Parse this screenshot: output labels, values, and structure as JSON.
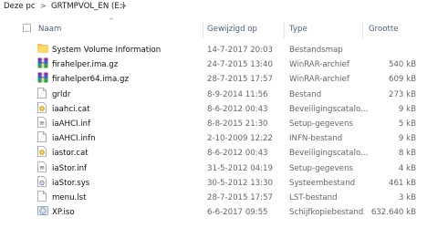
{
  "breadcrumb": {
    "items": [
      "Deze pc",
      "GRTMPVOL_EN (E:)"
    ],
    "separator": ">"
  },
  "columns": {
    "name": "Naam",
    "date": "Gewijzigd op",
    "type": "Type",
    "size": "Grootte"
  },
  "sort_indicator": "^",
  "files": [
    {
      "name": "System Volume Information",
      "date": "14-7-2017 20:03",
      "type": "Bestandsmap",
      "size": "",
      "icon": "folder-icon"
    },
    {
      "name": "firahelper.ima.gz",
      "date": "24-7-2015 13:40",
      "type": "WinRAR-archief",
      "size": "540 kB",
      "icon": "winrar-archive-icon"
    },
    {
      "name": "firahelper64.ima.gz",
      "date": "28-7-2015 17:57",
      "type": "WinRAR-archief",
      "size": "609 kB",
      "icon": "winrar-archive-icon"
    },
    {
      "name": "grldr",
      "date": "8-9-2014 11:56",
      "type": "Bestand",
      "size": "273 kB",
      "icon": "generic-file-icon"
    },
    {
      "name": "iaahci.cat",
      "date": "8-6-2012 00:43",
      "type": "Beveiligingscatalo...",
      "size": "9 kB",
      "icon": "security-catalog-icon"
    },
    {
      "name": "iaAHCI.inf",
      "date": "8-8-2015 21:30",
      "type": "Setup-gegevens",
      "size": "5 kB",
      "icon": "setup-info-icon"
    },
    {
      "name": "iaAHCI.infn",
      "date": "2-10-2009 12:22",
      "type": "INFN-bestand",
      "size": "9 kB",
      "icon": "generic-file-icon"
    },
    {
      "name": "iastor.cat",
      "date": "8-6-2012 00:43",
      "type": "Beveiligingscatalo...",
      "size": "8 kB",
      "icon": "security-catalog-icon"
    },
    {
      "name": "iaStor.inf",
      "date": "31-5-2012 04:19",
      "type": "Setup-gegevens",
      "size": "4 kB",
      "icon": "setup-info-icon"
    },
    {
      "name": "iaStor.sys",
      "date": "30-5-2012 13:30",
      "type": "Systeembestand",
      "size": "461 kB",
      "icon": "system-file-icon"
    },
    {
      "name": "menu.lst",
      "date": "28-7-2015 17:57",
      "type": "LST-bestand",
      "size": "3 kB",
      "icon": "generic-file-icon"
    },
    {
      "name": "XP.iso",
      "date": "6-6-2017 09:55",
      "type": "Schijfkopiebestand",
      "size": "632.640 kB",
      "icon": "disc-image-icon"
    }
  ]
}
